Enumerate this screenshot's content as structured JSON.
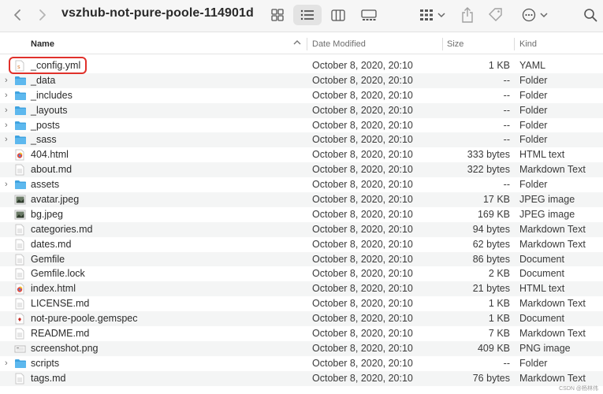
{
  "window": {
    "title": "vszhub-not-pure-poole-114901d"
  },
  "toolbar": {
    "back_icon": "chevron-left-icon",
    "forward_icon": "chevron-right-icon",
    "views": [
      "icon-view",
      "list-view",
      "column-view",
      "gallery-view"
    ],
    "active_view": "list-view",
    "group_icon": "group-by-icon",
    "share_icon": "share-icon",
    "tag_icon": "tag-icon",
    "more_icon": "ellipsis-icon",
    "search_icon": "search-icon"
  },
  "columns": {
    "name": "Name",
    "date": "Date Modified",
    "size": "Size",
    "kind": "Kind"
  },
  "sort": {
    "column": "Name",
    "direction": "ascending"
  },
  "files": [
    {
      "name": "_config.yml",
      "date": "October 8, 2020, 20:10",
      "size": "1 KB",
      "kind": "YAML",
      "type": "yaml",
      "selected": true
    },
    {
      "name": "_data",
      "date": "October 8, 2020, 20:10",
      "size": "--",
      "kind": "Folder",
      "type": "folder"
    },
    {
      "name": "_includes",
      "date": "October 8, 2020, 20:10",
      "size": "--",
      "kind": "Folder",
      "type": "folder"
    },
    {
      "name": "_layouts",
      "date": "October 8, 2020, 20:10",
      "size": "--",
      "kind": "Folder",
      "type": "folder"
    },
    {
      "name": "_posts",
      "date": "October 8, 2020, 20:10",
      "size": "--",
      "kind": "Folder",
      "type": "folder"
    },
    {
      "name": "_sass",
      "date": "October 8, 2020, 20:10",
      "size": "--",
      "kind": "Folder",
      "type": "folder"
    },
    {
      "name": "404.html",
      "date": "October 8, 2020, 20:10",
      "size": "333 bytes",
      "kind": "HTML text",
      "type": "html"
    },
    {
      "name": "about.md",
      "date": "October 8, 2020, 20:10",
      "size": "322 bytes",
      "kind": "Markdown Text",
      "type": "doc"
    },
    {
      "name": "assets",
      "date": "October 8, 2020, 20:10",
      "size": "--",
      "kind": "Folder",
      "type": "folder"
    },
    {
      "name": "avatar.jpeg",
      "date": "October 8, 2020, 20:10",
      "size": "17 KB",
      "kind": "JPEG image",
      "type": "image"
    },
    {
      "name": "bg.jpeg",
      "date": "October 8, 2020, 20:10",
      "size": "169 KB",
      "kind": "JPEG image",
      "type": "image"
    },
    {
      "name": "categories.md",
      "date": "October 8, 2020, 20:10",
      "size": "94 bytes",
      "kind": "Markdown Text",
      "type": "doc"
    },
    {
      "name": "dates.md",
      "date": "October 8, 2020, 20:10",
      "size": "62 bytes",
      "kind": "Markdown Text",
      "type": "doc"
    },
    {
      "name": "Gemfile",
      "date": "October 8, 2020, 20:10",
      "size": "86 bytes",
      "kind": "Document",
      "type": "doc"
    },
    {
      "name": "Gemfile.lock",
      "date": "October 8, 2020, 20:10",
      "size": "2 KB",
      "kind": "Document",
      "type": "doc"
    },
    {
      "name": "index.html",
      "date": "October 8, 2020, 20:10",
      "size": "21 bytes",
      "kind": "HTML text",
      "type": "html"
    },
    {
      "name": "LICENSE.md",
      "date": "October 8, 2020, 20:10",
      "size": "1 KB",
      "kind": "Markdown Text",
      "type": "doc"
    },
    {
      "name": "not-pure-poole.gemspec",
      "date": "October 8, 2020, 20:10",
      "size": "1 KB",
      "kind": "Document",
      "type": "gemspec"
    },
    {
      "name": "README.md",
      "date": "October 8, 2020, 20:10",
      "size": "7 KB",
      "kind": "Markdown Text",
      "type": "doc"
    },
    {
      "name": "screenshot.png",
      "date": "October 8, 2020, 20:10",
      "size": "409 KB",
      "kind": "PNG image",
      "type": "png"
    },
    {
      "name": "scripts",
      "date": "October 8, 2020, 20:10",
      "size": "--",
      "kind": "Folder",
      "type": "folder"
    },
    {
      "name": "tags.md",
      "date": "October 8, 2020, 20:10",
      "size": "76 bytes",
      "kind": "Markdown Text",
      "type": "doc"
    }
  ],
  "colors": {
    "folder": "#3fa3e0",
    "highlight": "#e0312b",
    "stripe": "#f4f5f5"
  },
  "watermark": "CSDN @杨林伟"
}
